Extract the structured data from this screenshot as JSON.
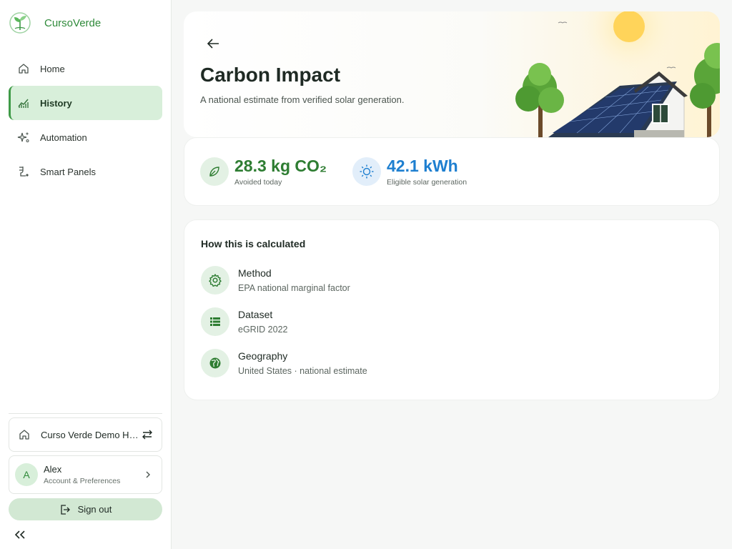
{
  "brand": {
    "name": "CursoVerde"
  },
  "sidebar": {
    "items": [
      {
        "label": "Home",
        "icon": "home-icon"
      },
      {
        "label": "History",
        "icon": "chart-icon",
        "active": true
      },
      {
        "label": "Automation",
        "icon": "sparkle-icon"
      },
      {
        "label": "Smart Panels",
        "icon": "plug-icon"
      }
    ],
    "home": {
      "name": "Curso Verde Demo Ho..."
    },
    "account": {
      "initial": "A",
      "name": "Alex",
      "subtitle": "Account & Preferences"
    },
    "signout_label": "Sign out"
  },
  "hero": {
    "title": "Carbon Impact",
    "subtitle": "A national estimate from verified solar generation."
  },
  "stats": [
    {
      "value": "28.3 kg CO₂",
      "label": "Avoided today",
      "color": "#2e7d32"
    },
    {
      "value": "42.1 kWh",
      "label": "Eligible solar generation",
      "color": "#1e7fd0"
    }
  ],
  "calc": {
    "title": "How this is calculated",
    "rows": [
      {
        "label": "Method",
        "value": "EPA national marginal factor",
        "icon": "gear-icon"
      },
      {
        "label": "Dataset",
        "value": "eGRID 2022",
        "icon": "list-icon"
      },
      {
        "label": "Geography",
        "value": "United States · national estimate",
        "icon": "globe-icon"
      }
    ]
  },
  "colors": {
    "accent": "#3f9a47",
    "active_bg": "#d8efda"
  }
}
